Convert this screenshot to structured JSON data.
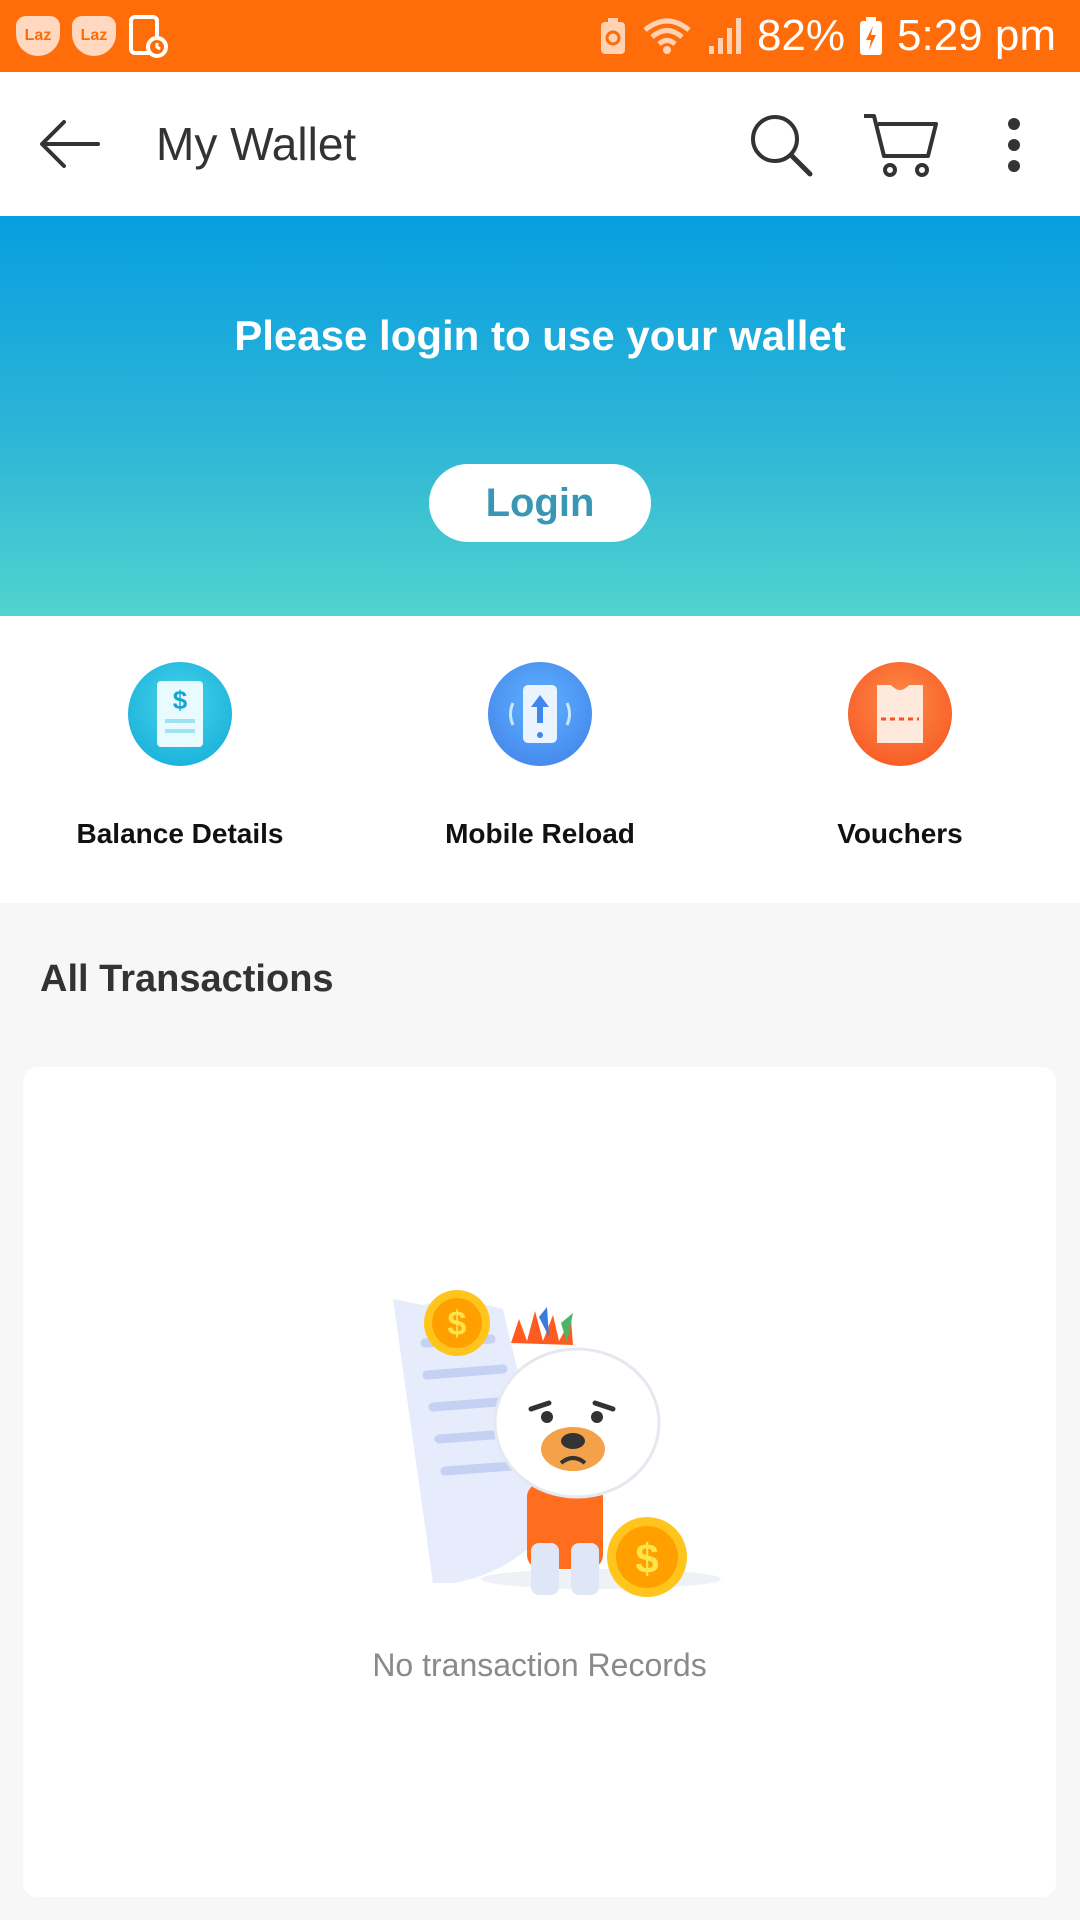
{
  "status_bar": {
    "battery": "82%",
    "time": "5:29 pm",
    "notification_badges": [
      "Laz",
      "Laz"
    ],
    "icons": [
      "lazada-notification-icon",
      "lazada-notification-icon",
      "screenshot-notification-icon",
      "recycle-icon",
      "wifi-icon",
      "signal-icon",
      "battery-charging-icon"
    ]
  },
  "header": {
    "title": "My Wallet",
    "icons": [
      "back-arrow-icon",
      "search-icon",
      "cart-icon",
      "more-vertical-icon"
    ]
  },
  "banner": {
    "message": "Please login to use your wallet",
    "login_label": "Login",
    "gradient": [
      "#079ee0",
      "#51d3cf"
    ]
  },
  "quick_actions": [
    {
      "label": "Balance Details",
      "icon": "balance-details-icon",
      "color": "#1fb8dc"
    },
    {
      "label": "Mobile Reload",
      "icon": "mobile-reload-icon",
      "color": "#4f8ff0"
    },
    {
      "label": "Vouchers",
      "icon": "voucher-icon",
      "color": "#ff6a2c"
    }
  ],
  "transactions": {
    "title": "All Transactions",
    "empty_text": "No transaction Records"
  },
  "colors": {
    "brand_orange": "#ff6d0a",
    "login_text": "#3a97b4"
  }
}
